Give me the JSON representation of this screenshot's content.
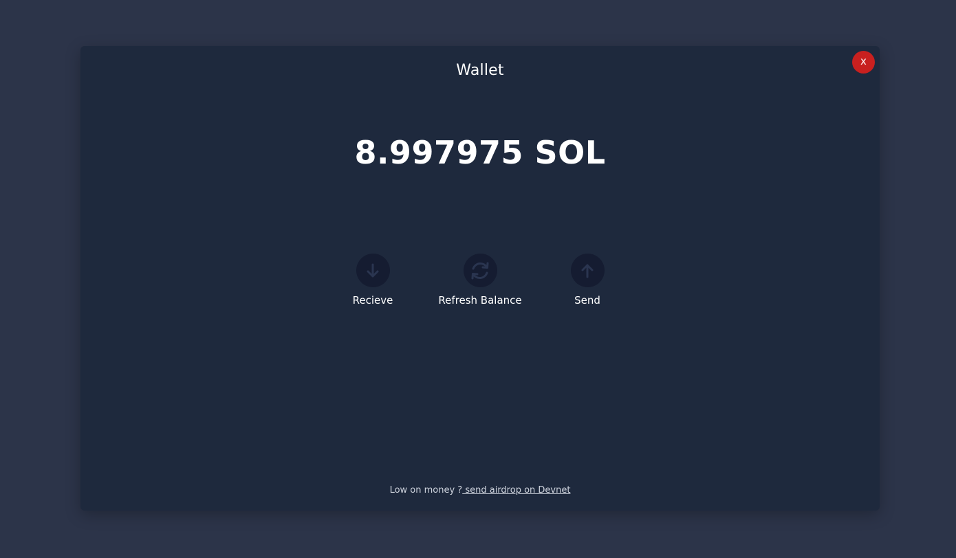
{
  "modal": {
    "close_label": "x",
    "title": "Wallet",
    "balance": "8.997975 SOL"
  },
  "actions": [
    {
      "label": "Recieve",
      "icon": "arrow-down-icon"
    },
    {
      "label": "Refresh Balance",
      "icon": "refresh-icon"
    },
    {
      "label": "Send",
      "icon": "arrow-up-icon"
    }
  ],
  "footer": {
    "text": "Low on money ?",
    "link_label": " send airdrop on Devnet"
  },
  "colors": {
    "page_bg": "#2c3449",
    "modal_bg": "#1e293d",
    "close_bg": "#c8201f",
    "action_circle_bg": "#151c31",
    "icon_color": "#2a3550"
  }
}
